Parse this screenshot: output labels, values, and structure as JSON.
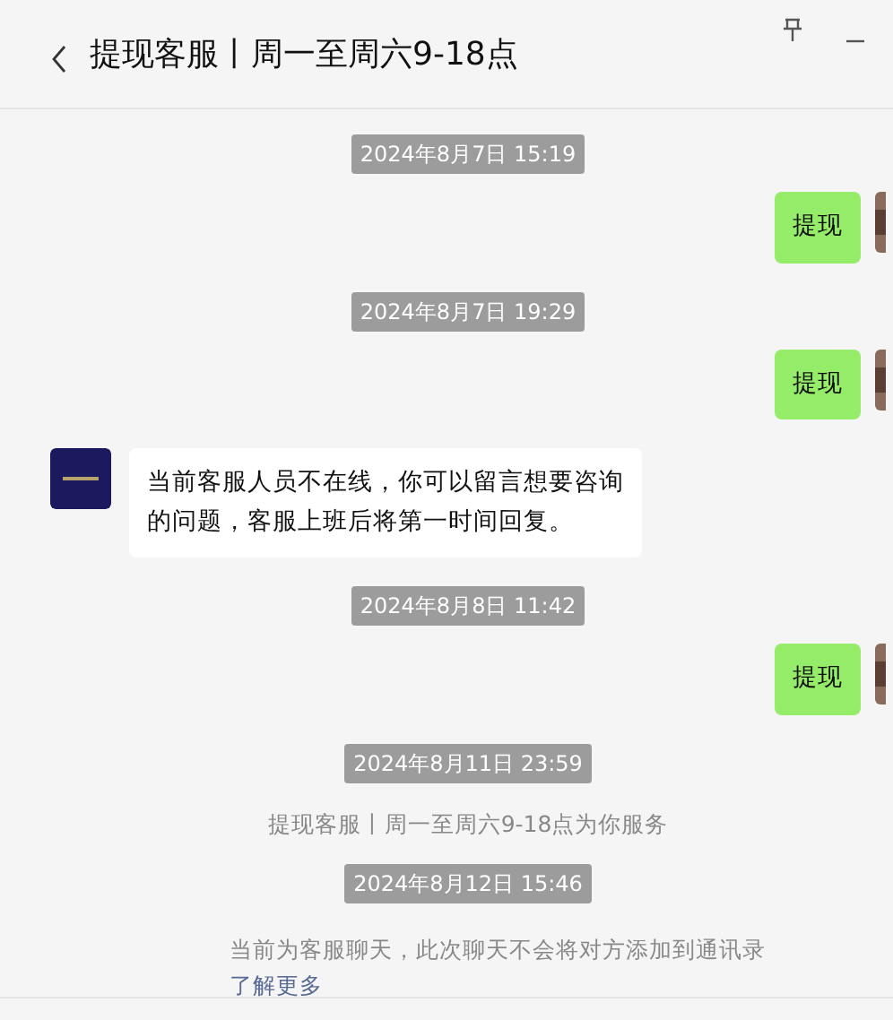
{
  "header": {
    "title": "提现客服丨周一至周六9-18点"
  },
  "messages": [
    {
      "kind": "time",
      "text": "2024年8月7日 15:19"
    },
    {
      "kind": "self",
      "text": "提现"
    },
    {
      "kind": "time",
      "text": "2024年8月7日 19:29"
    },
    {
      "kind": "self",
      "text": "提现"
    },
    {
      "kind": "other",
      "text": "当前客服人员不在线，你可以留言想要咨询的问题，客服上班后将第一时间回复。"
    },
    {
      "kind": "time",
      "text": "2024年8月8日 11:42"
    },
    {
      "kind": "self",
      "text": "提现"
    },
    {
      "kind": "time",
      "text": "2024年8月11日 23:59"
    },
    {
      "kind": "system",
      "text": "提现客服丨周一至周六9-18点为你服务"
    },
    {
      "kind": "time",
      "text": "2024年8月12日 15:46"
    },
    {
      "kind": "notice",
      "text": "当前为客服聊天，此次聊天不会将对方添加到通讯录",
      "link": "了解更多"
    }
  ]
}
